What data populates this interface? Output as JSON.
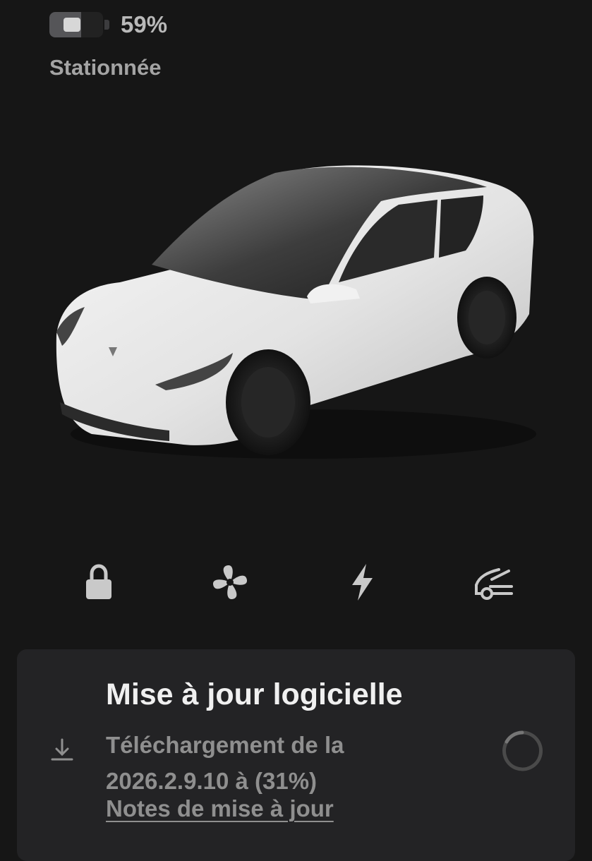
{
  "status": {
    "battery_percent_text": "59%",
    "battery_level": 0.59,
    "state": "Stationnée"
  },
  "vehicle": {
    "image": "white-suv-icon",
    "color": "#e9e9e9"
  },
  "quick_actions": [
    {
      "icon": "lock-icon"
    },
    {
      "icon": "fan-icon"
    },
    {
      "icon": "lightning-bolt-icon"
    },
    {
      "icon": "trunk-open-icon"
    }
  ],
  "update_card": {
    "title": "Mise à jour logicielle",
    "description_line1": "Téléchargement de la",
    "description_line2": "2026.2.9.10 à (31%)",
    "progress_percent": 31,
    "notes_link": "Notes de mise à jour",
    "icon": "download-icon",
    "status_icon": "spinner-icon"
  },
  "colors": {
    "background": "#161616",
    "card": "#232325",
    "text_primary": "#f0f0f0",
    "text_secondary": "#8f8f8f",
    "icon": "#c9c9c9"
  }
}
